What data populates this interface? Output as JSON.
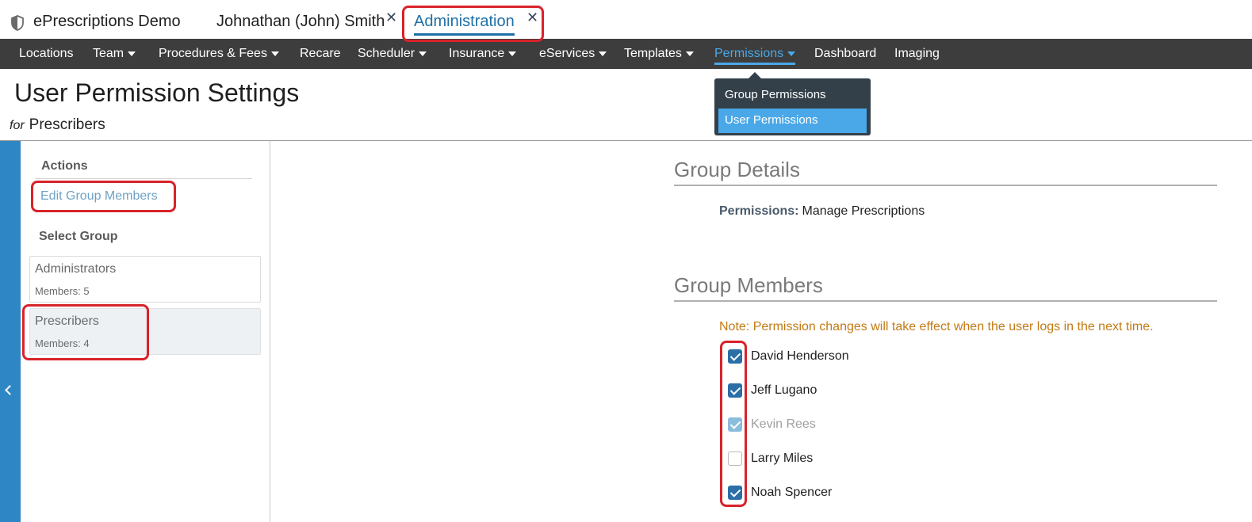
{
  "app": {
    "title": "ePrescriptions Demo",
    "icon": "shield-icon"
  },
  "tabs": [
    {
      "label": "Johnathan (John) Smith",
      "closable": true
    },
    {
      "label": "Administration",
      "closable": true,
      "active": true
    }
  ],
  "tab_close_glyph": "✕",
  "nav": {
    "items": [
      {
        "label": "Locations",
        "has_caret": false
      },
      {
        "label": "Team",
        "has_caret": true
      },
      {
        "label": "Procedures & Fees",
        "has_caret": true
      },
      {
        "label": "Recare",
        "has_caret": false
      },
      {
        "label": "Scheduler",
        "has_caret": true
      },
      {
        "label": "Insurance",
        "has_caret": true
      },
      {
        "label": "eServices",
        "has_caret": true
      },
      {
        "label": "Templates",
        "has_caret": true
      },
      {
        "label": "Permissions",
        "has_caret": true,
        "active": true
      },
      {
        "label": "Dashboard",
        "has_caret": false
      },
      {
        "label": "Imaging",
        "has_caret": false
      }
    ],
    "dropdown": {
      "items": [
        {
          "label": "Group Permissions"
        },
        {
          "label": "User Permissions",
          "highlighted": true
        }
      ]
    }
  },
  "page": {
    "title": "User Permission Settings",
    "sub_prefix": "for",
    "sub_value": "Prescribers"
  },
  "sidebar": {
    "actions_heading": "Actions",
    "edit_link": "Edit Group Members",
    "select_heading": "Select Group",
    "groups": [
      {
        "name": "Administrators",
        "members": "Members: 5"
      },
      {
        "name": "Prescribers",
        "members": "Members: 4",
        "selected": true
      }
    ]
  },
  "main": {
    "details_title": "Group Details",
    "permissions_label": "Permissions:",
    "permissions_value": "Manage Prescriptions",
    "members_title": "Group Members",
    "note": "Note: Permission changes will take effect when the user logs in the next time.",
    "members": [
      {
        "name": "David Henderson",
        "checked": true,
        "disabled": false
      },
      {
        "name": "Jeff Lugano",
        "checked": true,
        "disabled": false
      },
      {
        "name": "Kevin Rees",
        "checked": true,
        "disabled": true
      },
      {
        "name": "Larry Miles",
        "checked": false,
        "disabled": false
      },
      {
        "name": "Noah Spencer",
        "checked": true,
        "disabled": false
      }
    ]
  },
  "colors": {
    "accent": "#1f6fa6",
    "nav_bg": "#3d3d3d",
    "nav_active": "#4aa8e8",
    "annotation_red": "#d8232a",
    "note_orange": "#c27a14",
    "collapse_strip": "#2f86c4"
  }
}
